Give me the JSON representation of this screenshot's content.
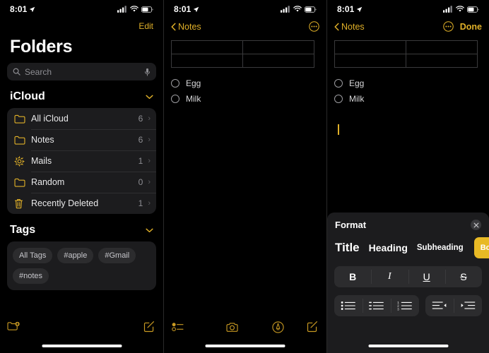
{
  "status_bar": {
    "time": "8:01",
    "location_icon": "location-arrow-icon",
    "signal_icon": "cellular-signal-icon",
    "wifi_icon": "wifi-icon",
    "battery_icon": "battery-icon"
  },
  "panel_folders": {
    "edit_label": "Edit",
    "title": "Folders",
    "search": {
      "placeholder": "Search",
      "icon": "search-icon",
      "mic_icon": "microphone-icon"
    },
    "icloud_section": {
      "title": "iCloud",
      "chevron": "chevron-down-icon"
    },
    "folders": [
      {
        "label": "All iCloud",
        "count": "6",
        "icon": "folder-icon"
      },
      {
        "label": "Notes",
        "count": "6",
        "icon": "folder-icon"
      },
      {
        "label": "Mails",
        "count": "1",
        "icon": "gear-icon"
      },
      {
        "label": "Random",
        "count": "0",
        "icon": "folder-icon"
      },
      {
        "label": "Recently Deleted",
        "count": "1",
        "icon": "trash-icon"
      }
    ],
    "tags_section": {
      "title": "Tags",
      "chevron": "chevron-down-icon"
    },
    "tags": [
      "All Tags",
      "#apple",
      "#Gmail",
      "#notes"
    ],
    "toolbar": {
      "new_folder_icon": "new-folder-icon",
      "compose_icon": "compose-icon"
    }
  },
  "panel_note": {
    "back_label": "Notes",
    "more_icon": "more-ellipsis-icon",
    "table": {
      "rows": 2,
      "cols": 2,
      "cells": [
        [
          "",
          ""
        ],
        [
          "",
          ""
        ]
      ]
    },
    "checklist": [
      {
        "label": "Egg",
        "checked": false
      },
      {
        "label": "Milk",
        "checked": false
      }
    ],
    "toolbar": {
      "checklist_icon": "checklist-icon",
      "camera_icon": "camera-icon",
      "markup_icon": "markup-pen-icon",
      "compose_icon": "compose-icon"
    }
  },
  "panel_format": {
    "back_label": "Notes",
    "more_icon": "more-ellipsis-icon",
    "done_label": "Done",
    "table": {
      "rows": 2,
      "cols": 2,
      "cells": [
        [
          "",
          ""
        ],
        [
          "",
          ""
        ]
      ]
    },
    "checklist": [
      {
        "label": "Egg",
        "checked": false
      },
      {
        "label": "Milk",
        "checked": false
      }
    ],
    "sheet": {
      "title": "Format",
      "close_icon": "close-icon",
      "styles": [
        {
          "label": "Title",
          "selected": false
        },
        {
          "label": "Heading",
          "selected": false
        },
        {
          "label": "Subheading",
          "selected": false
        },
        {
          "label": "Body",
          "selected": true
        }
      ],
      "text_buttons": [
        {
          "label": "B",
          "name": "bold-button"
        },
        {
          "label": "I",
          "name": "italic-button"
        },
        {
          "label": "U",
          "name": "underline-button"
        },
        {
          "label": "S",
          "name": "strikethrough-button"
        }
      ],
      "list_buttons": [
        "bulleted-list-icon",
        "dashed-list-icon",
        "numbered-list-icon"
      ],
      "indent_buttons": [
        "decrease-indent-icon",
        "increase-indent-icon"
      ],
      "accent_color": "#e8b925"
    }
  }
}
